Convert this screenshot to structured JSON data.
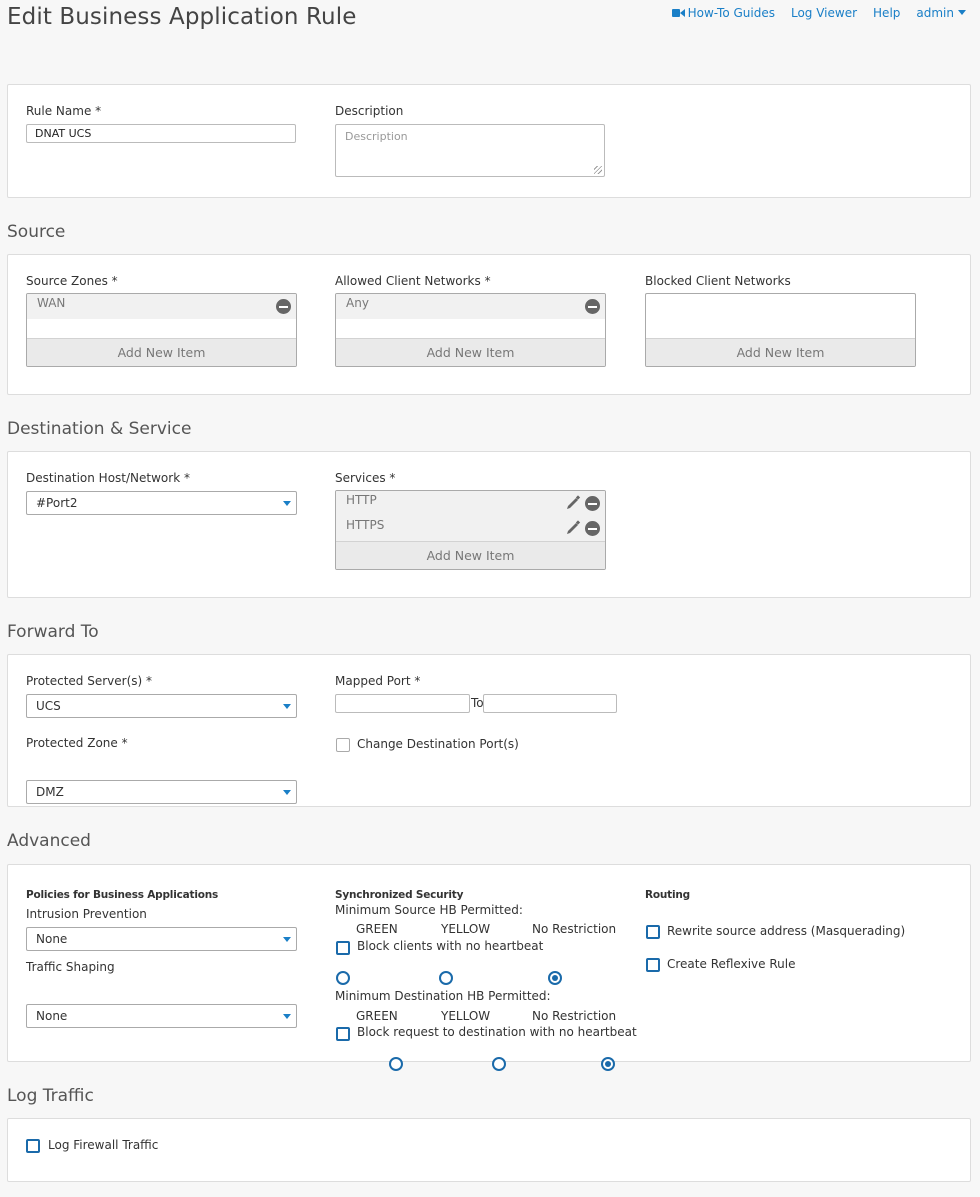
{
  "page": {
    "title": "Edit Business Application Rule"
  },
  "nav": {
    "howto": "How-To Guides",
    "logviewer": "Log Viewer",
    "help": "Help",
    "admin": "admin"
  },
  "general": {
    "rule_name_label": "Rule Name *",
    "rule_name_value": "DNAT UCS",
    "description_label": "Description",
    "description_placeholder": "Description"
  },
  "source": {
    "title": "Source",
    "zones_label": "Source Zones *",
    "zones_items": [
      "WAN"
    ],
    "allowed_label": "Allowed Client Networks *",
    "allowed_items": [
      "Any"
    ],
    "blocked_label": "Blocked Client Networks",
    "add_new_item": "Add New Item"
  },
  "destination": {
    "title": "Destination & Service",
    "host_label": "Destination Host/Network *",
    "host_value": "#Port2",
    "services_label": "Services *",
    "services_items": [
      "HTTP",
      "HTTPS"
    ],
    "add_new_item": "Add New Item"
  },
  "forward": {
    "title": "Forward To",
    "server_label": "Protected Server(s) *",
    "server_value": "UCS",
    "zone_label": "Protected Zone *",
    "zone_value": "DMZ",
    "mapped_port_label": "Mapped Port *",
    "to_label": "To",
    "change_dest_port": "Change Destination Port(s)"
  },
  "advanced": {
    "title": "Advanced",
    "policies_heading": "Policies for Business Applications",
    "ips_label": "Intrusion Prevention",
    "ips_value": "None",
    "shaping_label": "Traffic Shaping",
    "shaping_value": "None",
    "sync_heading": "Synchronized Security",
    "src_hb_label": "Minimum Source HB Permitted:",
    "dst_hb_label": "Minimum Destination HB Permitted:",
    "hb_options": [
      "GREEN",
      "YELLOW",
      "No Restriction"
    ],
    "hb_selected": "No Restriction",
    "block_clients": "Block clients with no heartbeat",
    "block_request": "Block request to destination with no heartbeat",
    "routing_heading": "Routing",
    "rewrite_source": "Rewrite source address (Masquerading)",
    "reflexive": "Create Reflexive Rule"
  },
  "log": {
    "title": "Log Traffic",
    "log_firewall": "Log Firewall Traffic"
  },
  "colors": {
    "accent": "#1a7fc7",
    "radio": "#1a6aaa",
    "background": "#f7f7f7"
  }
}
